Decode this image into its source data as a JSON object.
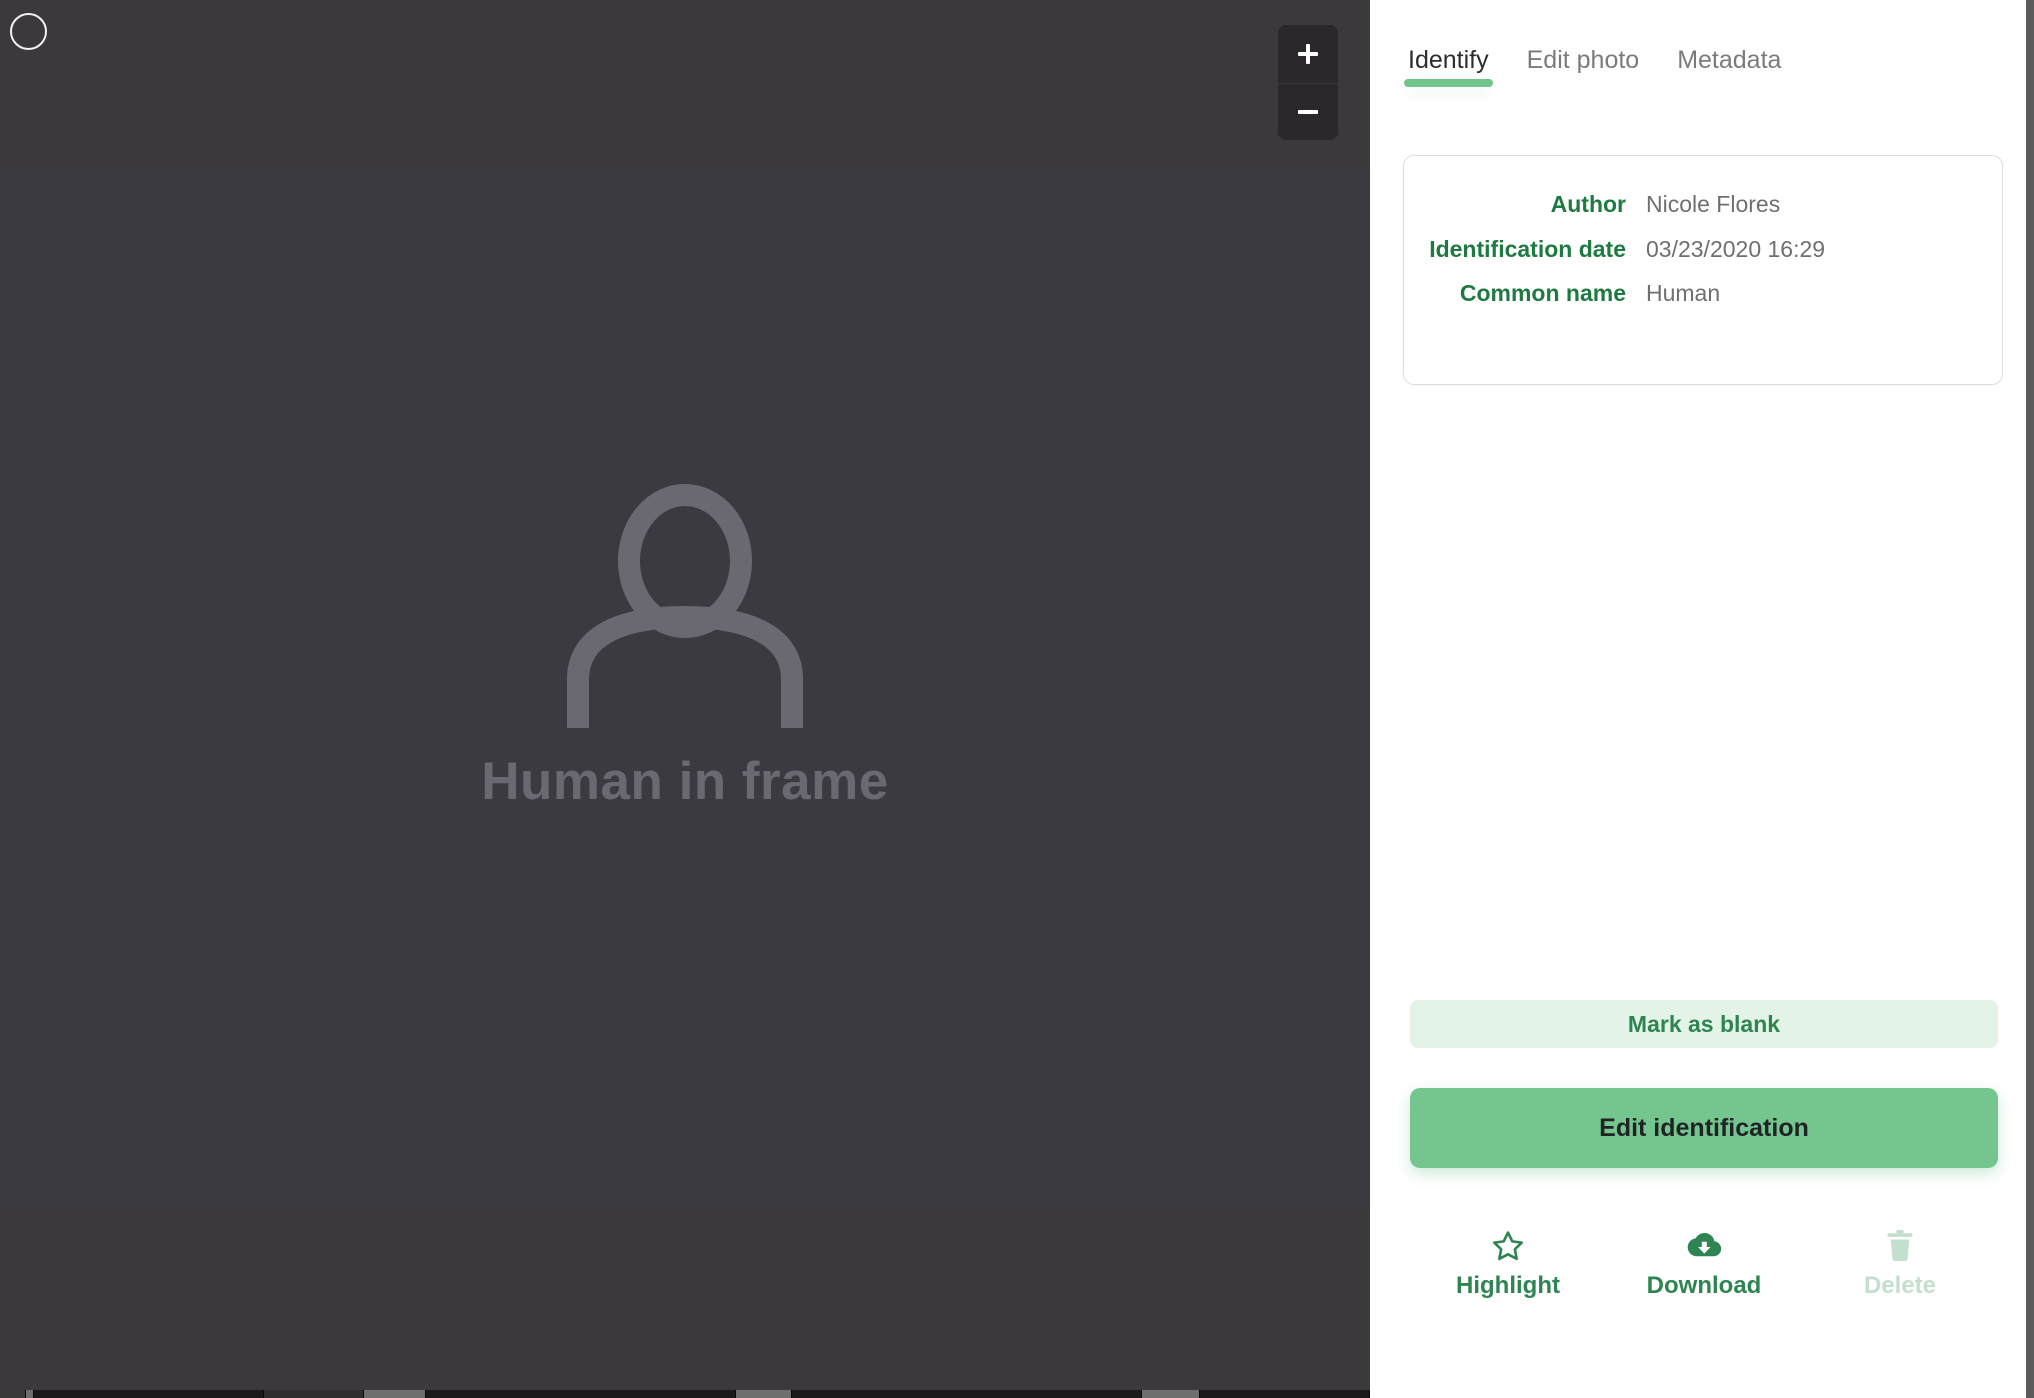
{
  "viewer": {
    "select_circle_name": "selection-circle",
    "zoom_in_label": "+",
    "zoom_out_label": "−",
    "placeholder_label": "Human in frame",
    "placeholder_icon": "person-icon",
    "background_color": "#3c3a41",
    "toolbar_color": "#3b393c"
  },
  "panel": {
    "tabs": [
      {
        "label": "Identify",
        "active": true
      },
      {
        "label": "Edit photo",
        "active": false
      },
      {
        "label": "Metadata",
        "active": false
      }
    ],
    "info_card": {
      "rows": [
        {
          "label": "Author",
          "value": "Nicole Flores"
        },
        {
          "label": "Identification date",
          "value": "03/23/2020 16:29"
        },
        {
          "label": "Common name",
          "value": "Human"
        }
      ]
    },
    "actions": {
      "mark_blank_label": "Mark as blank",
      "edit_identification_label": "Edit identification"
    },
    "footer": [
      {
        "label": "Highlight",
        "icon": "star-icon",
        "disabled": false
      },
      {
        "label": "Download",
        "icon": "cloud-download-icon",
        "disabled": false
      },
      {
        "label": "Delete",
        "icon": "trash-icon",
        "disabled": true
      }
    ],
    "colors": {
      "accent_green": "#6fc58c",
      "button_green": "#74c68e",
      "pale_green": "#e4f3e8",
      "label_green": "#1f7a41",
      "text_green": "#2e8552",
      "disabled_green": "#c3dfcd"
    }
  }
}
